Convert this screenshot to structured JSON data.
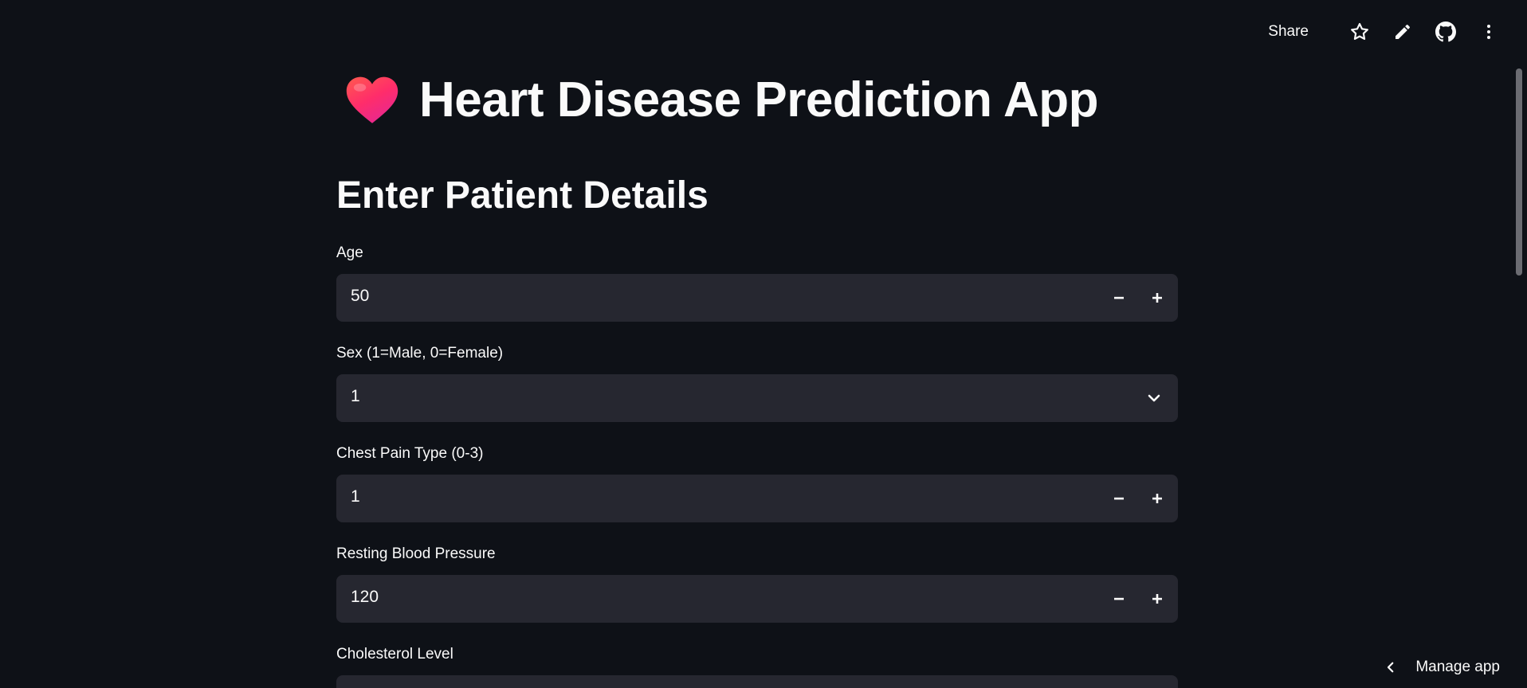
{
  "toolbar": {
    "share_label": "Share",
    "icons": [
      "star-icon",
      "pencil-icon",
      "github-icon",
      "more-vertical-icon"
    ]
  },
  "app": {
    "title": "Heart Disease Prediction App",
    "title_icon": "heart-icon",
    "section_title": "Enter Patient Details"
  },
  "fields": [
    {
      "label": "Age",
      "value": "50",
      "type": "number"
    },
    {
      "label": "Sex (1=Male, 0=Female)",
      "value": "1",
      "type": "select"
    },
    {
      "label": "Chest Pain Type (0-3)",
      "value": "1",
      "type": "number"
    },
    {
      "label": "Resting Blood Pressure",
      "value": "120",
      "type": "number"
    },
    {
      "label": "Cholesterol Level",
      "value": "",
      "type": "number"
    }
  ],
  "footer": {
    "manage_label": "Manage app"
  },
  "colors": {
    "background": "#0e1117",
    "input_background": "#262730",
    "text": "#fafafa"
  }
}
